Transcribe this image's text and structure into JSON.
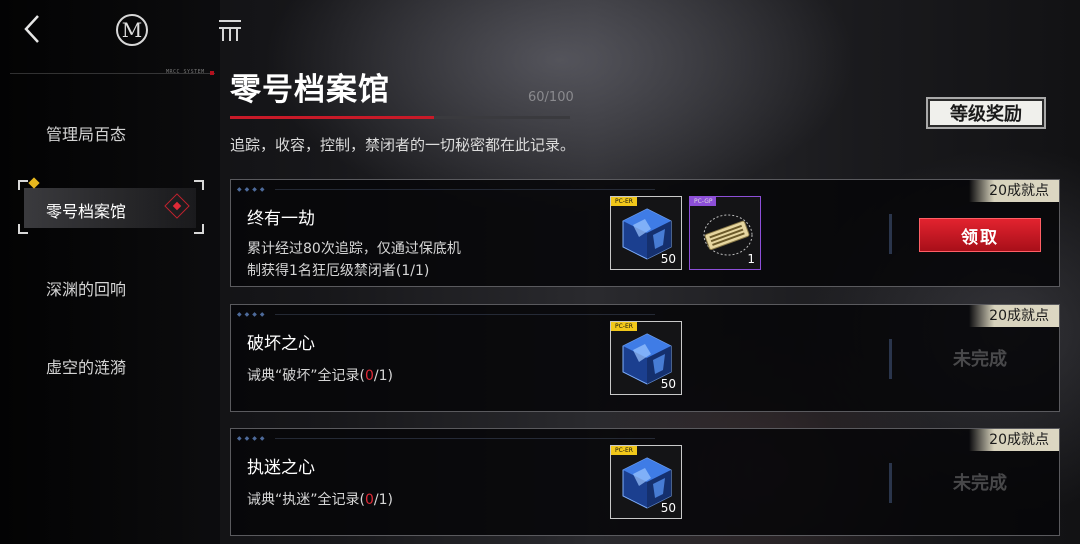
{
  "sidebar": {
    "system_label": "MRCC SYSTEM",
    "items": [
      {
        "label": "管理局百态",
        "active": false
      },
      {
        "label": "零号档案馆",
        "active": true
      },
      {
        "label": "深渊的回响",
        "active": false
      },
      {
        "label": "虚空的涟漪",
        "active": false
      }
    ]
  },
  "header": {
    "title": "零号档案馆",
    "progress_text": "60/100",
    "progress_fraction": 0.6,
    "subtitle": "追踪，收容，控制，禁闭者的一切秘密都在此记录。",
    "level_reward_label": "等级奖励"
  },
  "tasks": [
    {
      "title": "终有一劫",
      "desc_line1": "累计经过80次追踪，仅通过保底机",
      "desc_line2": "制获得1名狂厄级禁闭者(1/1)",
      "points": "20成就点",
      "action_label": "领取",
      "rewards": [
        {
          "tag": "PC-ER",
          "qty": "50",
          "icon": "crystal-cube-icon"
        },
        {
          "tag": "PC-GP",
          "qty": "1",
          "icon": "ticket-icon"
        }
      ]
    },
    {
      "title": "破坏之心",
      "desc_prefix": "诫典“破坏”全记录(",
      "desc_progress": "0",
      "desc_suffix": "/1)",
      "points": "20成就点",
      "status": "未完成",
      "rewards": [
        {
          "tag": "PC-ER",
          "qty": "50",
          "icon": "crystal-cube-icon"
        }
      ]
    },
    {
      "title": "执迷之心",
      "desc_prefix": "诫典“执迷”全记录(",
      "desc_progress": "0",
      "desc_suffix": "/1)",
      "points": "20成就点",
      "status": "未完成",
      "rewards": [
        {
          "tag": "PC-ER",
          "qty": "50",
          "icon": "crystal-cube-icon"
        }
      ]
    }
  ],
  "colors": {
    "accent_red": "#e02a37",
    "gold": "#e8b81e",
    "purple": "#8d4fd8"
  }
}
